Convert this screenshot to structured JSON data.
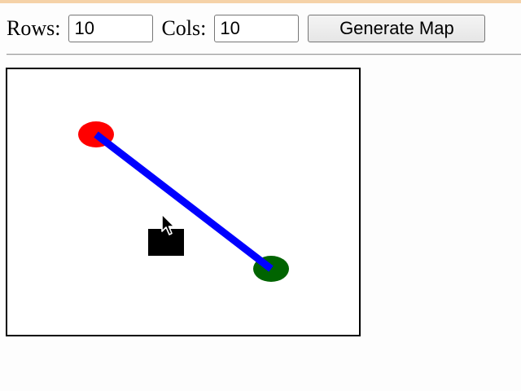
{
  "controls": {
    "rows_label": "Rows:",
    "rows_value": "10",
    "cols_label": "Cols:",
    "cols_value": "10",
    "generate_label": "Generate Map"
  },
  "map": {
    "start_color": "#ff0000",
    "end_color": "#006400",
    "path_color": "#0000ff",
    "obstacle_color": "#000000",
    "cursor_icon": "arrow-cursor-icon"
  }
}
